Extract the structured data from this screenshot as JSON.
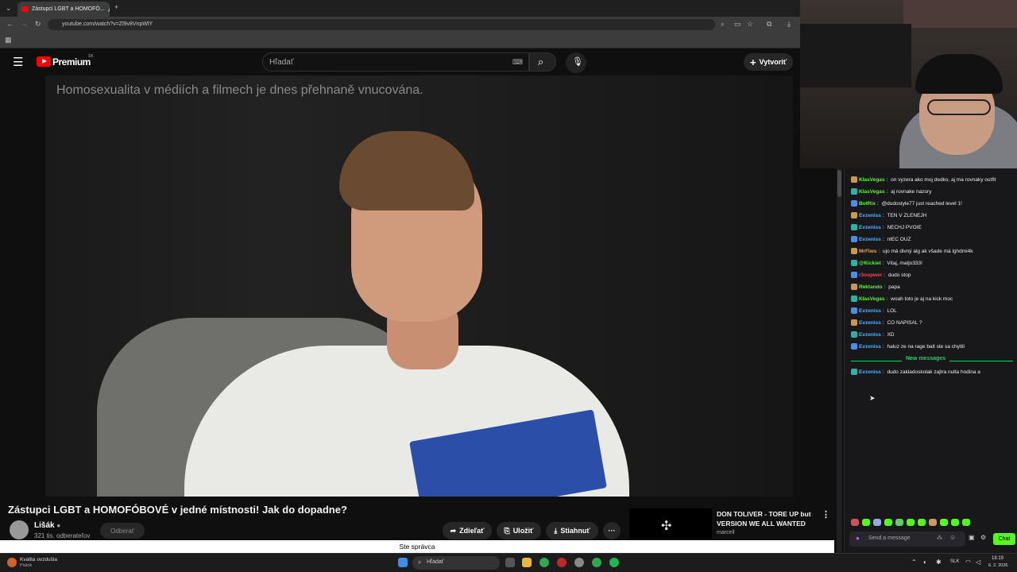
{
  "browser": {
    "tab_title": "Zástupci LGBT a HOMOFÓ...",
    "url": "youtube.com/watch?v=Zl9v8VnpWlY",
    "new_tab_symbol": "+",
    "close_symbol": "×"
  },
  "youtube": {
    "logo_text": "Premium",
    "region": "SK",
    "search_placeholder": "Hľadať",
    "create_label": "Vytvoriť",
    "video_caption": "Homosexualita v médiích a filmech je dnes přehnaně vnucována.",
    "video_title": "Zástupci LGBT a HOMOFÓBOVÉ v jedné místnosti! Jak do dopadne?",
    "channel_name": "Lišák",
    "subscribers": "321 tis. odberateľov",
    "subscribe_label": "Odberať",
    "actions": [
      "Zdieľať",
      "Uložiť",
      "Stiahnuť"
    ],
    "more_label": "···",
    "recommendation": {
      "title_line1": "DON TOLIVER - TORE UP but",
      "title_line2": "VERSION WE ALL WANTED",
      "channel": "marcell"
    },
    "status_text": "Ste správca"
  },
  "chat": {
    "messages": [
      {
        "user": "KlasVegas",
        "color": "#53fc18",
        "text": "on vyzera ako moj dedko, aj ma rovnaky outfit"
      },
      {
        "user": "KlasVegas",
        "color": "#53fc18",
        "text": "aj rovnake nazory"
      },
      {
        "user": "BotRix",
        "color": "#53fc18",
        "text": "@dudostyle77 just reached level 1!"
      },
      {
        "user": "Evzeniss",
        "color": "#4fb0ff",
        "text": "TEN V ZLENEJH"
      },
      {
        "user": "Evzeniss",
        "color": "#4fb0ff",
        "text": "NECHJ PVOIE"
      },
      {
        "user": "Evzeniss",
        "color": "#4fb0ff",
        "text": "nIEC OUZ"
      },
      {
        "user": "MrFiws",
        "color": "#f5a623",
        "text": "ujo má divný alg ak všade má lghdmi4k"
      },
      {
        "user": "@Kickiet",
        "color": "#53fc18",
        "text": "Vitaj, matjo333!"
      },
      {
        "user": "r3oopwer",
        "color": "#ff3b5c",
        "text": "dudo stop"
      },
      {
        "user": "Rektando",
        "color": "#53fc18",
        "text": "papa"
      },
      {
        "user": "KlasVegas",
        "color": "#53fc18",
        "text": "woah toto je aj na kick moc"
      },
      {
        "user": "Evzeniss",
        "color": "#4fb0ff",
        "text": "LOL"
      },
      {
        "user": "Evzeniss",
        "color": "#4fb0ff",
        "text": "CO NAPISAL ?"
      },
      {
        "user": "Evzeniss",
        "color": "#4fb0ff",
        "text": "XD"
      },
      {
        "user": "Evzeniss",
        "color": "#4fb0ff",
        "text": "haluz ze na rage balt ste sa chytili"
      }
    ],
    "new_messages_label": "New messages",
    "new_message": {
      "user": "Evzeniss",
      "color": "#4fb0ff",
      "text": "dudo zakladoskolak zajtra nulta hodina a"
    },
    "input_placeholder": "Send a message",
    "chat_button": "Chat"
  },
  "taskbar": {
    "weather_title": "Kvalita ovzdušia",
    "weather_sub": "Piatok",
    "search_label": "Hľadať",
    "language": "SLK",
    "time": "18:19",
    "date": "6. 2. 2026"
  }
}
